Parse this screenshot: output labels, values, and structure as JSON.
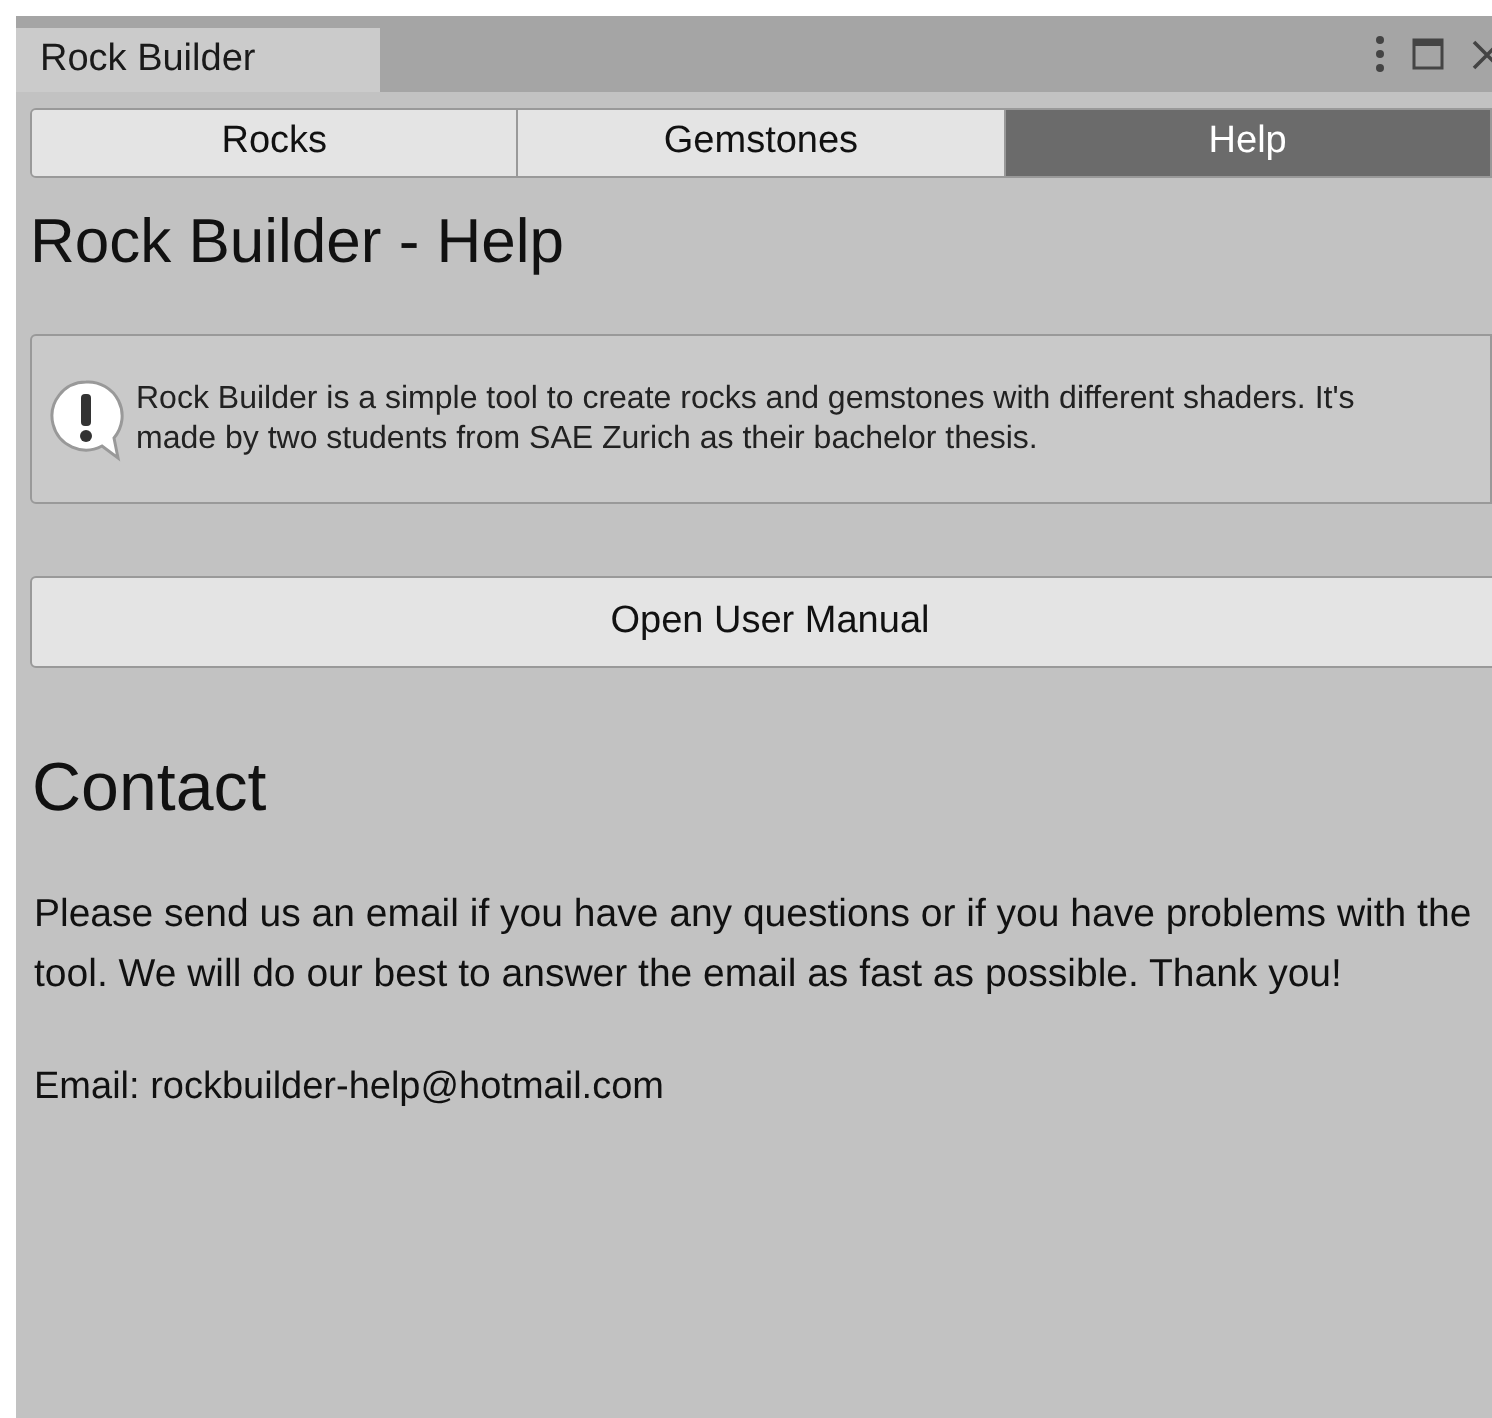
{
  "window": {
    "title": "Rock Builder"
  },
  "tabs": [
    {
      "label": "Rocks",
      "selected": false
    },
    {
      "label": "Gemstones",
      "selected": false
    },
    {
      "label": "Help",
      "selected": true
    }
  ],
  "heading": "Rock Builder - Help",
  "info_box": {
    "text": "Rock Builder is a simple tool to create rocks and gemstones with different shaders. It's made by two students from SAE Zurich as their bachelor thesis."
  },
  "manual_button": "Open User Manual",
  "contact": {
    "heading": "Contact",
    "paragraph": "Please send us an email if you have any questions or if you have problems with the tool. We will do our best to answer the email as fast as possible. Thank you!",
    "email": "Email: rockbuilder-help@hotmail.com"
  }
}
